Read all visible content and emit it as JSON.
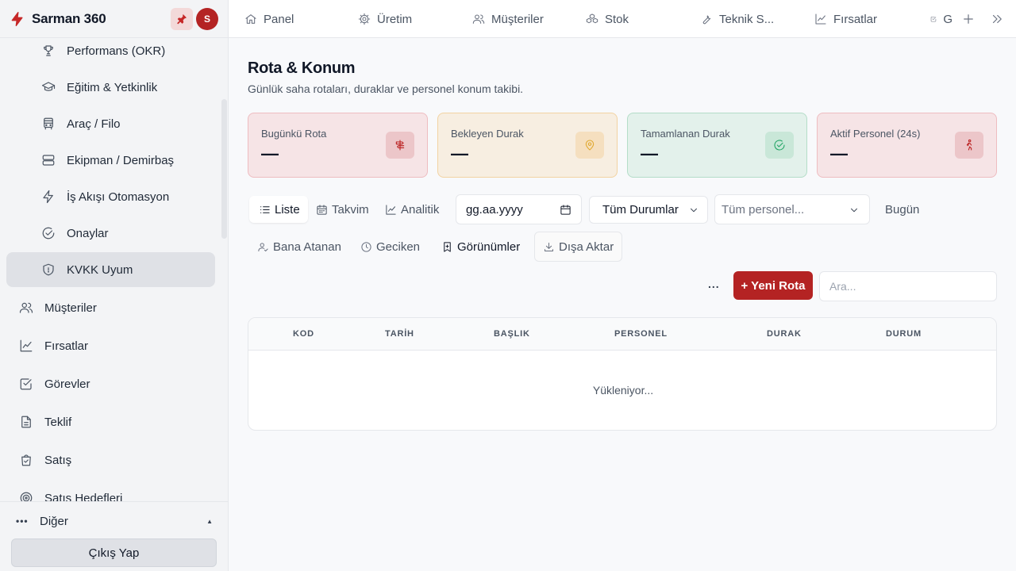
{
  "brand": {
    "name": "Sarman 360",
    "avatar_initial": "S"
  },
  "sidebar": {
    "sub_items": [
      {
        "label": "Performans (OKR)",
        "icon": "trophy-icon"
      },
      {
        "label": "Eğitim & Yetkinlik",
        "icon": "graduation-cap-icon"
      },
      {
        "label": "Araç / Filo",
        "icon": "bus-icon"
      },
      {
        "label": "Ekipman / Demirbaş",
        "icon": "server-icon"
      },
      {
        "label": "İş Akışı Otomasyon",
        "icon": "zap-icon"
      },
      {
        "label": "Onaylar",
        "icon": "check-circle-icon"
      },
      {
        "label": "KVKK Uyum",
        "icon": "shield-icon",
        "active": true
      }
    ],
    "top_items": [
      {
        "label": "Müşteriler",
        "icon": "users-icon"
      },
      {
        "label": "Fırsatlar",
        "icon": "trend-icon"
      },
      {
        "label": "Görevler",
        "icon": "check-square-icon"
      },
      {
        "label": "Teklif",
        "icon": "file-icon"
      },
      {
        "label": "Satış",
        "icon": "shopping-bag-icon"
      },
      {
        "label": "Satış Hedefleri",
        "icon": "target-icon"
      }
    ],
    "more_label": "Diğer",
    "logout_label": "Çıkış Yap"
  },
  "topbar": {
    "tabs": [
      {
        "label": "Panel",
        "icon": "home-icon"
      },
      {
        "label": "Üretim",
        "icon": "gear-icon"
      },
      {
        "label": "Müşteriler",
        "icon": "users-icon"
      },
      {
        "label": "Stok",
        "icon": "boxes-icon"
      },
      {
        "label": "Teknik S...",
        "icon": "wrench-icon"
      },
      {
        "label": "Fırsatlar",
        "icon": "trend-icon"
      },
      {
        "label": "G",
        "icon": "check-square-icon"
      }
    ]
  },
  "page": {
    "title": "Rota & Konum",
    "subtitle": "Günlük saha rotaları, duraklar ve personel konum takibi."
  },
  "stats": [
    {
      "label": "Bugünkü Rota",
      "value": "—",
      "icon": "signpost-icon",
      "color": "#b91c1c"
    },
    {
      "label": "Bekleyen Durak",
      "value": "—",
      "icon": "map-pin-icon",
      "color": "#e0a82e"
    },
    {
      "label": "Tamamlanan Durak",
      "value": "—",
      "icon": "check-circle-icon",
      "color": "#22a565"
    },
    {
      "label": "Aktif Personel (24s)",
      "value": "—",
      "icon": "walking-icon",
      "color": "#b91c1c"
    }
  ],
  "toolbar": {
    "views": {
      "list": "Liste",
      "calendar": "Takvim",
      "analytics": "Analitik"
    },
    "date_placeholder": "gg.aa.yyyy",
    "status_select": "Tüm Durumlar",
    "staff_select": "Tüm personel...",
    "today": "Bugün",
    "assigned_to_me": "Bana Atanan",
    "overdue": "Geciken",
    "views_menu": "Görünümler",
    "export": "Dışa Aktar",
    "more": "...",
    "new_route": "+ Yeni Rota",
    "search_placeholder": "Ara..."
  },
  "table": {
    "columns": [
      "KOD",
      "TARİH",
      "BAŞLIK",
      "PERSONEL",
      "DURAK",
      "DURUM"
    ],
    "loading": "Yükleniyor..."
  },
  "colors": {
    "accent": "#b42323"
  }
}
